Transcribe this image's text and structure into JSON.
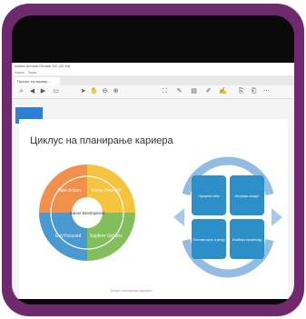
{
  "window": {
    "title": "Adobe Acrobat Reader DC (32-bit)",
    "menu": [
      "Home",
      "Tools"
    ],
    "tab_label": "Процес на кариер..."
  },
  "toolbar": {
    "zoom_value": ""
  },
  "sidebar": {
    "button_label": ""
  },
  "slide": {
    "title": "Циклус на планирање кариера",
    "wheel": {
      "center_label": "Career Development",
      "segments": [
        "Take Action",
        "Know Yourself",
        "Explore Options",
        "Get Focused"
      ],
      "colors": [
        "#f07b2b",
        "#f4b81c",
        "#6cb33f",
        "#2a88c9"
      ]
    },
    "cycle": {
      "boxes": [
        "Процена себе",
        "Истражи опције",
        "Изабери професију",
        "Постави циљ и делуј"
      ],
      "box_color": "#2d8fc7",
      "arrow_color": "#7fb1dc"
    },
    "caption": "Процес планирања каријере"
  }
}
